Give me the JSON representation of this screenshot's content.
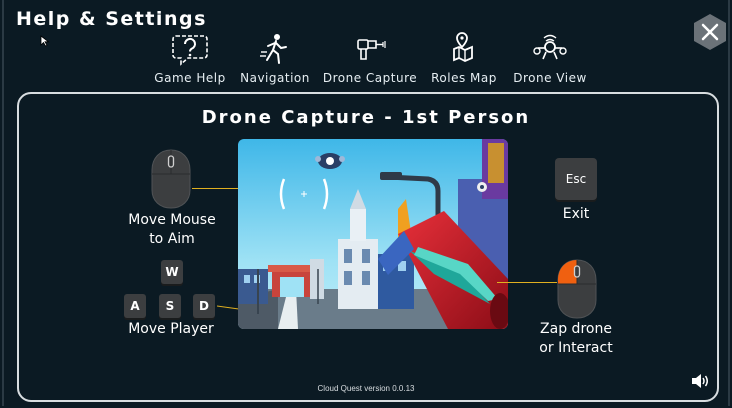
{
  "header": {
    "title": "Help & Settings"
  },
  "nav": {
    "items": [
      {
        "label": "Game Help",
        "icon": "question-bubble-icon"
      },
      {
        "label": "Navigation",
        "icon": "walking-person-icon"
      },
      {
        "label": "Drone Capture",
        "icon": "zapper-gun-icon"
      },
      {
        "label": "Roles Map",
        "icon": "map-pin-icon"
      },
      {
        "label": "Drone View",
        "icon": "drone-icon"
      }
    ]
  },
  "panel": {
    "title": "Drone Capture - 1st Person",
    "aim_label_line1": "Move Mouse",
    "aim_label_line2": "to Aim",
    "keys": {
      "w": "W",
      "a": "A",
      "s": "S",
      "d": "D"
    },
    "move_label": "Move Player",
    "esc_key": "Esc",
    "exit_label": "Exit",
    "zap_label_line1": "Zap drone",
    "zap_label_line2": "or Interact"
  },
  "footer": {
    "version": "Cloud Quest version 0.0.13"
  },
  "colors": {
    "background": "#0b1a23",
    "accent_line": "#e0b020",
    "mouse_highlight": "#f06010",
    "close_bg": "#6b7278"
  }
}
